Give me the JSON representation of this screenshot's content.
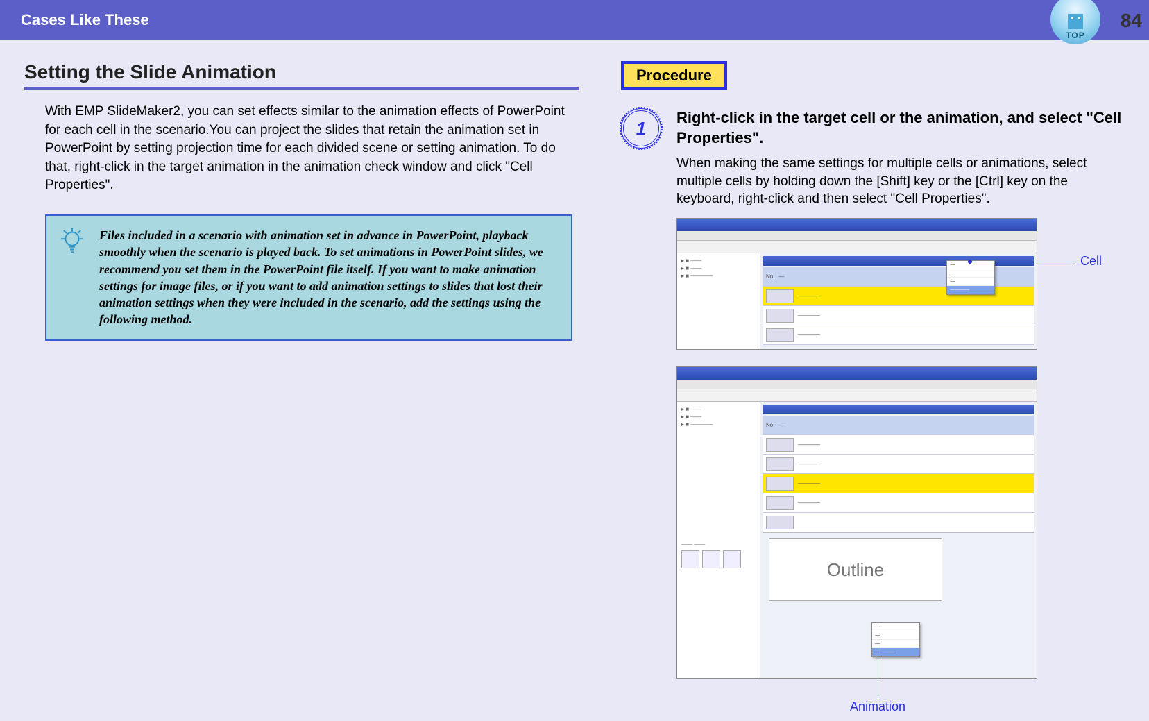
{
  "header": {
    "title": "Cases Like These",
    "page_number": "84",
    "top_button_label": "TOP"
  },
  "section": {
    "title": "Setting the Slide Animation",
    "body": "With EMP SlideMaker2, you can set effects similar to the animation effects of PowerPoint for each cell in the scenario.You can project the slides that retain the animation set in PowerPoint by setting projection time for each divided scene or setting animation.\nTo do that, right-click in the target animation in the animation check window and click \"Cell Properties\"."
  },
  "tip": {
    "text": "Files included in a scenario with animation set in advance in PowerPoint, playback smoothly when the scenario is played back. To set animations in PowerPoint slides, we recommend you set them in the PowerPoint file itself. If you want to make animation settings for image files, or if you want to add animation settings to slides that lost their animation settings when they were included in the scenario, add the settings using the following method."
  },
  "procedure": {
    "label": "Procedure",
    "step_number": "1",
    "step_title": "Right-click in the target cell or the animation, and select \"Cell Properties\".",
    "step_text": "When making the same settings for multiple cells or animations, select multiple cells by holding down the [Shift] key or the [Ctrl] key on the keyboard, right-click and then select \"Cell Properties\"."
  },
  "callouts": {
    "cell": "Cell",
    "animation": "Animation"
  },
  "screenshot_text": {
    "outline": "Outline"
  }
}
